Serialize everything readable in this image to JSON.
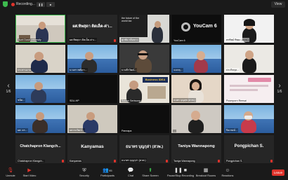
{
  "topbar": {
    "recording_label": "Recording...",
    "view_label": "View"
  },
  "pager": {
    "left_page": "1/6",
    "right_page": "1/6"
  },
  "tiles": [
    {
      "name": "Aunt Dusit university"
    },
    {
      "name": "ผศ.ทิพสุดา ดิตเล็ค-ค่าเ...",
      "big": "ผศ.ทิพสุดา ติดเล็ค-ค่า..."
    },
    {
      "name": "ศุภชัย กลิ่นขาว",
      "overlay": "the future of the world tax"
    },
    {
      "name": "YouCam 6",
      "overlay": "YouCam 6"
    },
    {
      "name": "พรทิพย์ ทิพยะ (สวพ.)"
    },
    {
      "name": "ประสานงาน"
    },
    {
      "name": "นางสาวพนิดา..."
    },
    {
      "name": "นายธีรวัฒน์..."
    },
    {
      "name": "จงเกตุ..."
    },
    {
      "name": "ประกิตกุล..."
    },
    {
      "name": "ชนิด..."
    },
    {
      "name": "SDU-HP"
    },
    {
      "name": "Sulcon Seriwong",
      "overlay": "Business IDEA"
    },
    {
      "name": "ธนพร บุญสุข (สวพ.)"
    },
    {
      "name": "Poomporn Reesai"
    },
    {
      "name": "ผศ. ดร..."
    },
    {
      "name": "ผศ.ธนวัฒน์..."
    },
    {
      "name": "Pannapa"
    },
    {
      "name": "..."
    },
    {
      "name": "ปิยะพงษ์..."
    },
    {
      "name": "Chatchapron Klangch...",
      "big": "Chatchapron Klangch..."
    },
    {
      "name": "Kanyamas",
      "big": "Kanyamas"
    },
    {
      "name": "ธนาทร บุญกุล่า (สวพ.)",
      "big": "ธนาทร บุญกุล่า (สวพ.)"
    },
    {
      "name": "Taniya Wannapong",
      "big": "Taniya Wannapong"
    },
    {
      "name": "Pongpichan S.",
      "big": "Pongpichan S."
    }
  ],
  "toolbar": {
    "unmute": "Unmute",
    "start_video": "Start Video",
    "security": "Security",
    "participants": "Participants",
    "participants_count": "95",
    "chat": "Chat",
    "share_screen": "Share Screen",
    "pause_recording": "Pause/Stop Recording",
    "breakout_rooms": "Breakout Rooms",
    "reactions": "Reactions",
    "leave": "Leave"
  },
  "colors": {
    "leave": "#e0332b",
    "share": "#3dba4e",
    "record": "#e0332b"
  }
}
